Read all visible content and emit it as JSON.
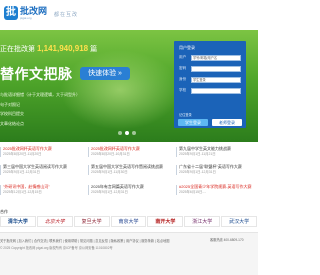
{
  "header": {
    "logo_mark": "批",
    "logo_text": "批改网",
    "logo_subtext": "pigai.org",
    "slogan": "都在互改"
  },
  "hero": {
    "count_prefix": "正在批改第",
    "count_number": "1,141,940,918",
    "count_suffix": "篇",
    "headline": "替作文把脉",
    "cta_label": "快速体验 »",
    "features": [
      "与批语详细错（计于文理逻辑，大于词型升）",
      "句子对照记",
      "学校科目提交",
      "文章化结论点"
    ],
    "dots": 3,
    "active_dot": 1
  },
  "login": {
    "title": "用户登录",
    "username_label": "用户",
    "username_value": "学号/邮箱/用户名",
    "password_label": "密码",
    "password_value": "",
    "role_label": "身份",
    "role_value": "学生登录",
    "school_label": "学校",
    "school_value": "",
    "remember_label": "记住登录",
    "login_button": "学生登录",
    "register_button": "老师登录"
  },
  "news": [
    {
      "title": "2025批改网杯英语写作大赛",
      "date": "2025年8月20日-11月20日",
      "color": "red"
    },
    {
      "title": "2025批改网杯英语写作大赛",
      "date": "2025年8月20日-10月31日",
      "color": "red"
    },
    {
      "title": "第九届中学生英文能力挑战赛",
      "date": "2025年9月1日-11月21日",
      "color": "dark"
    },
    {
      "title": "第三届中国大学生英语阅读写作大赛",
      "date": "2025年9月1日-12月31日",
      "color": "dark"
    },
    {
      "title": "第五届中国大学生英语写作暨阅读挑战赛",
      "date": "2025年9月1日-11月30日",
      "color": "dark"
    },
    {
      "title": "广东省十二届\"联盟杯\"英语写作大赛",
      "date": "2025年9月1日-12月31日",
      "color": "dark"
    },
    {
      "title": "\"外研讯中国，赴情感山河\"",
      "date": "2025年12月1日-12月15日",
      "color": "red"
    },
    {
      "title": "2025年有言网篇英语写作大赛",
      "date": "2025年9月1日-12月31日",
      "color": "dark"
    },
    {
      "title": "#2025全国青少年学院规赛-英语写作大赛",
      "date": "2025年6月15日-...",
      "color": "red"
    }
  ],
  "links": {
    "label": "合作",
    "items": [
      "清华大学",
      "北京大学",
      "复旦大学",
      "南京大学",
      "南开大学",
      "浙江大学",
      "武汉大学"
    ]
  },
  "footer": {
    "links": "关于批改网 | 加入我们 | 合作交流 | 联系我们 | 使用帮助 | 常见问题 | 意见反馈 | 隐私政策 | 用户协议 | 服务条款 | 站点地图",
    "copyright": "© 2025 Copyright 批改网 pigai.org 版权所有 京ICP备号 京公网安备 11010802号",
    "phone": "客服热线 400-6809-170"
  }
}
